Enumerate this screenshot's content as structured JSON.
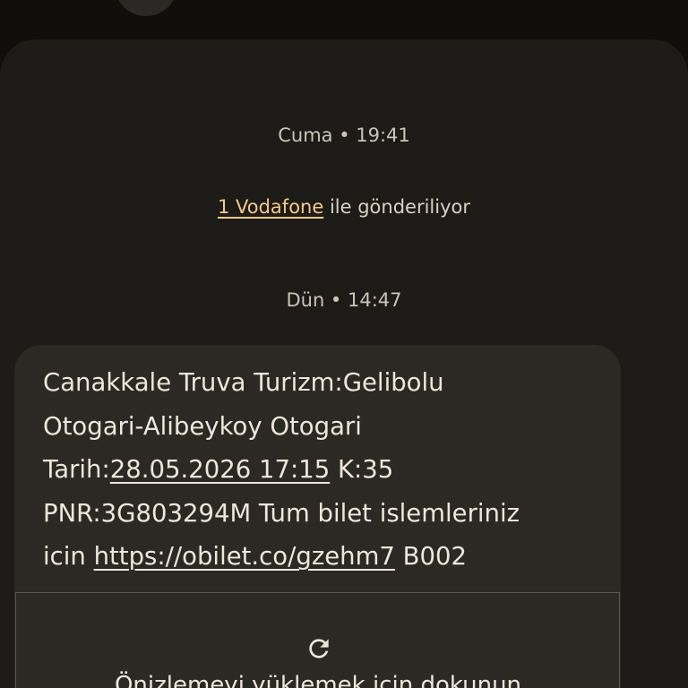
{
  "conversation": {
    "timestamp_1": "Cuma • 19:41",
    "sending_sim": "1 Vodafone",
    "sending_suffix": " ile gönderiliyor",
    "timestamp_2": "Dün • 14:47"
  },
  "message": {
    "line_1": "Canakkale Truva Turizm:Gelibolu",
    "line_2": "Otogari-Alibeykoy Otogari",
    "line_3_prefix": "Tarih:",
    "line_3_date": "28.05.2026 17:15",
    "line_3_suffix": " K:35",
    "line_4": "PNR:3G803294M Tum bilet islemleriniz",
    "line_5_prefix": "icin ",
    "line_5_link": "https://obilet.co/gzehm7",
    "line_5_suffix": " B002"
  },
  "preview": {
    "icon": "refresh-icon",
    "label": "Önizlemeyi yüklemek için dokunun"
  },
  "colors": {
    "background": "#0f0e0c",
    "sheet": "#1d1b17",
    "bubble": "#2b2924",
    "link_accent": "#f3c98b"
  }
}
